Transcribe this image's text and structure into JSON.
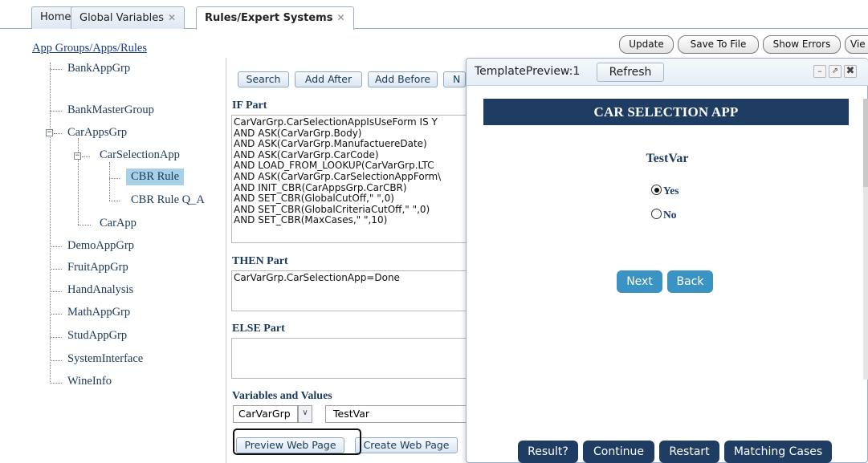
{
  "tabs": [
    {
      "label": "Home",
      "closable": false
    },
    {
      "label": "Global Variables",
      "closable": true
    },
    {
      "label": "Rules/Expert Systems",
      "closable": true
    }
  ],
  "toolbar": {
    "update": "Update",
    "save_to_file": "Save To File",
    "show_errors": "Show Errors",
    "view": "Vie"
  },
  "tree": {
    "root": "App Groups/Apps/Rules",
    "nodes": {
      "bank_app_grp": "BankAppGrp",
      "bank_master_group": "BankMasterGroup",
      "car_apps_grp": "CarAppsGrp",
      "car_selection_app": "CarSelectionApp",
      "cbr_rule": "CBR Rule",
      "cbr_rule_qa": "CBR Rule Q_A",
      "car_app": "CarApp",
      "demo_app_grp": "DemoAppGrp",
      "fruit_app_grp": "FruitAppGrp",
      "hand_analysis": "HandAnalysis",
      "math_app_grp": "MathAppGrp",
      "stud_app_grp": "StudAppGrp",
      "system_interface": "SystemInterface",
      "wine_info": "WineInfo"
    },
    "selected": "CBR Rule"
  },
  "editor": {
    "buttons": {
      "search": "Search",
      "add_after": "Add After",
      "add_before": "Add Before",
      "next_cut": "N"
    },
    "if_label": "IF Part",
    "if_lines": [
      "CarVarGrp.CarSelectionAppIsUseForm IS Y",
      "AND ASK(CarVarGrp.Body)",
      "AND ASK(CarVarGrp.ManufactuereDate)",
      "AND ASK(CarVarGrp.CarCode)",
      "AND LOAD_FROM_LOOKUP(CarVarGrp.LTC",
      "AND ASK(CarVarGrp.CarSelectionAppForm\\",
      "AND INIT_CBR(CarAppsGrp.CarCBR)",
      "AND SET_CBR(GlobalCutOff,\" \",0)",
      "AND SET_CBR(GlobalCriteriaCutOff,\" \",0)",
      "AND SET_CBR(MaxCases,\" \",10)"
    ],
    "then_label": "THEN Part",
    "then_text": "CarVarGrp.CarSelectionApp=Done",
    "else_label": "ELSE Part",
    "else_text": "",
    "vars_label": "Variables and Values",
    "var_group": "CarVarGrp",
    "var_name": "TestVar",
    "preview_btn": "Preview Web Page",
    "create_btn": "Create Web Page"
  },
  "preview": {
    "title": "TemplatePreview:1",
    "refresh": "Refresh",
    "app_title": "CAR SELECTION APP",
    "question": "TestVar",
    "options": [
      {
        "label": "Yes",
        "checked": true
      },
      {
        "label": "No",
        "checked": false
      }
    ],
    "next": "Next",
    "back": "Back",
    "footer_buttons": [
      "Result?",
      "Continue",
      "Restart",
      "Matching Cases"
    ]
  }
}
